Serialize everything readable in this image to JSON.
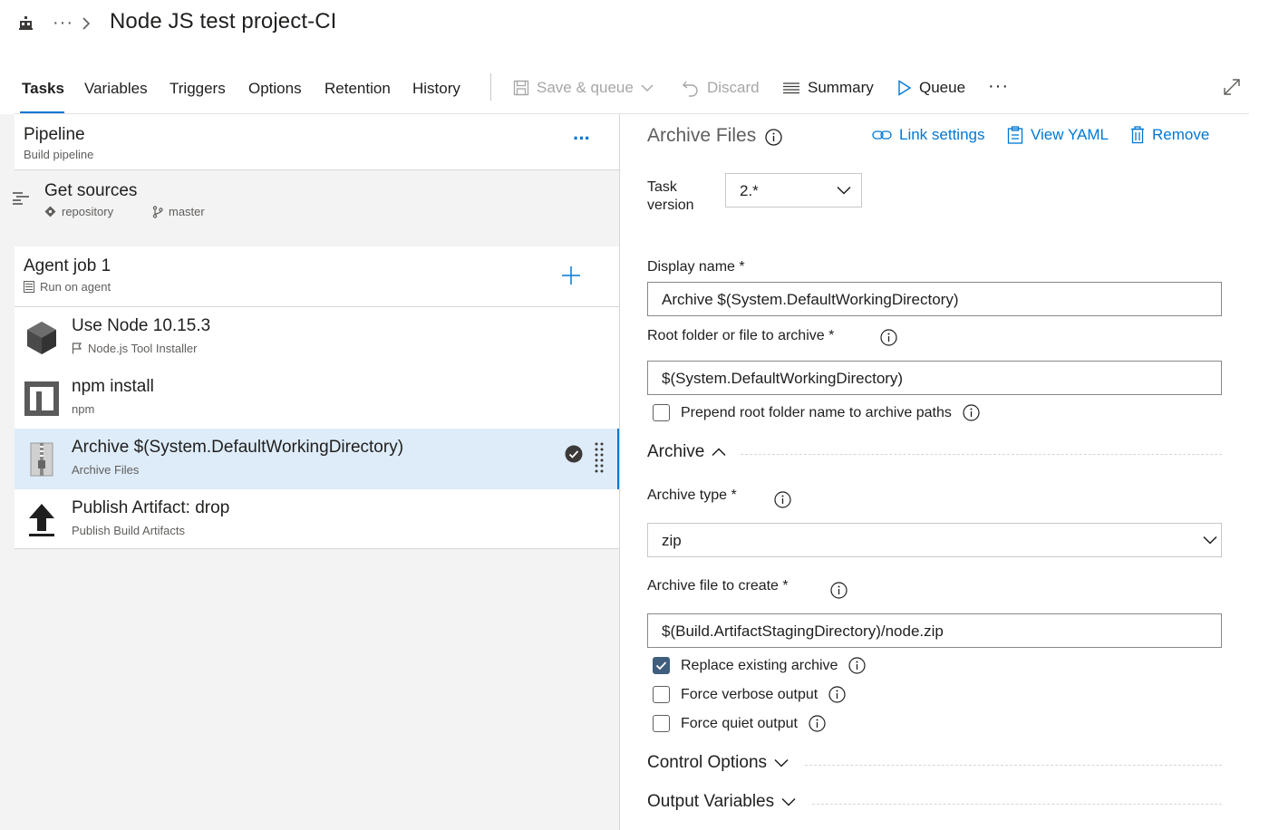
{
  "header": {
    "title": "Node JS test project-CI",
    "breadcrumb_more": "···"
  },
  "tabs": [
    {
      "label": "Tasks",
      "active": true
    },
    {
      "label": "Variables"
    },
    {
      "label": "Triggers"
    },
    {
      "label": "Options"
    },
    {
      "label": "Retention"
    },
    {
      "label": "History"
    }
  ],
  "toolbar": {
    "save_queue": "Save & queue",
    "discard": "Discard",
    "summary": "Summary",
    "queue": "Queue",
    "more": "···"
  },
  "pipeline": {
    "title": "Pipeline",
    "subtitle": "Build pipeline",
    "more": "···"
  },
  "get_sources": {
    "title": "Get sources",
    "repository": "repository",
    "branch": "master"
  },
  "agent_job": {
    "title": "Agent job 1",
    "subtitle": "Run on agent"
  },
  "tasks": [
    {
      "title": "Use Node 10.15.3",
      "subtitle": "Node.js Tool Installer"
    },
    {
      "title": "npm install",
      "subtitle": "npm"
    },
    {
      "title": "Archive $(System.DefaultWorkingDirectory)",
      "subtitle": "Archive Files",
      "selected": true
    },
    {
      "title": "Publish Artifact: drop",
      "subtitle": "Publish Build Artifacts"
    }
  ],
  "details": {
    "title": "Archive Files",
    "link_settings": "Link settings",
    "view_yaml": "View YAML",
    "remove": "Remove",
    "task_version_label_1": "Task",
    "task_version_label_2": "version",
    "task_version_value": "2.*",
    "display_name_label": "Display name *",
    "display_name_value": "Archive $(System.DefaultWorkingDirectory)",
    "root_folder_label": "Root folder or file to archive *",
    "root_folder_value": "$(System.DefaultWorkingDirectory)",
    "prepend_label": "Prepend root folder name to archive paths",
    "prepend_checked": false,
    "archive_section": "Archive",
    "archive_type_label": "Archive type *",
    "archive_type_value": "zip",
    "archive_file_label": "Archive file to create *",
    "archive_file_value": "$(Build.ArtifactStagingDirectory)/node.zip",
    "replace_label": "Replace existing archive",
    "replace_checked": true,
    "verbose_label": "Force verbose output",
    "verbose_checked": false,
    "quiet_label": "Force quiet output",
    "quiet_checked": false,
    "control_options": "Control Options",
    "output_variables": "Output Variables"
  },
  "colors": {
    "accent": "#0078d4",
    "selected_bg": "#deecf9",
    "panel_bg": "#f3f3f3",
    "checkbox_checked": "#3f5e7d"
  }
}
